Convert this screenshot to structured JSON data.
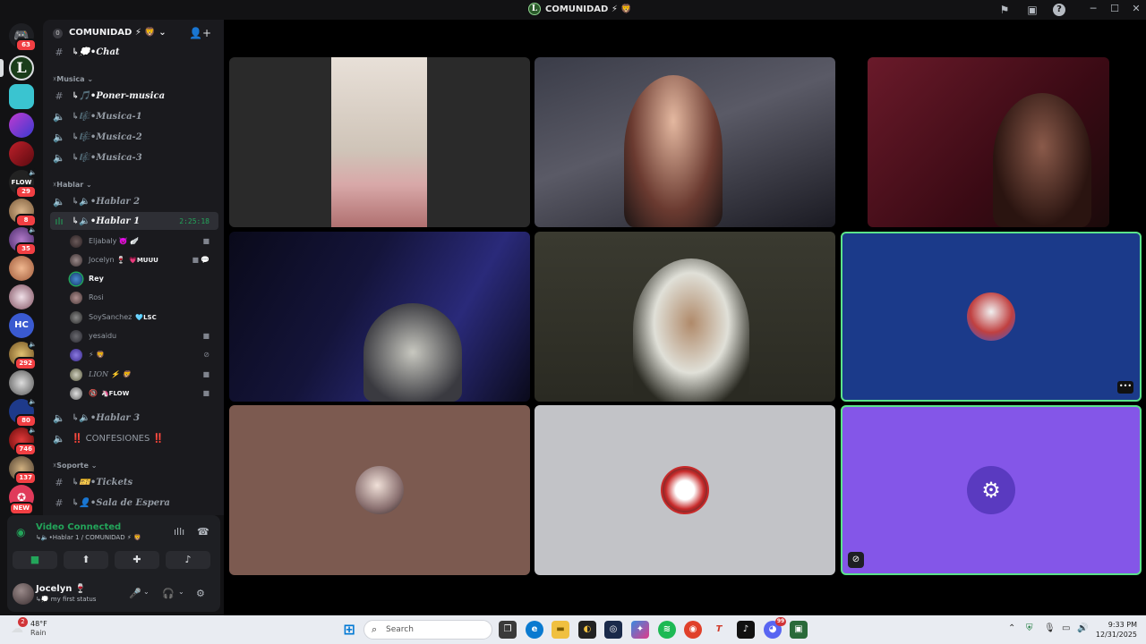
{
  "window": {
    "title": "COMUNIDAD ⚡ 🦁",
    "logo_letter": "L"
  },
  "server": {
    "name": "COMUNIDAD ⚡ 🦁",
    "chevron": "⌄",
    "boost": "0"
  },
  "rail_badges": [
    "63",
    "29",
    "8",
    "35",
    "292",
    "80",
    "746",
    "137",
    "NEW"
  ],
  "categories": {
    "musica": "☓Musica ⌄",
    "hablar": "☓Hablar ⌄",
    "soporte": "☓Soporte ⌄"
  },
  "channels": {
    "chat": "↳💭•Chat",
    "poner_musica": "↳🎵•Poner-musica",
    "musica1": "↳🎼•Musica-1",
    "musica2": "↳🎼•Musica-2",
    "musica3": "↳🎼•Musica-3",
    "hablar2": "↳🔈•Hablar 2",
    "hablar1": "↳🔈•Hablar 1",
    "hablar1_timer": "2:25:18",
    "hablar3": "↳🔈•Hablar 3",
    "confesiones": "‼️ CONFESIONES ‼️",
    "tickets": "↳🎫•Tickets",
    "sala": "↳👤•Sala de Espera"
  },
  "voice_users": [
    {
      "name": "Eljabaly 👿 🪽",
      "tag": ""
    },
    {
      "name": "Jocelyn 🍷",
      "tag": "💗MUUU"
    },
    {
      "name": "Rey",
      "tag": ""
    },
    {
      "name": "Rosi",
      "tag": ""
    },
    {
      "name": "SoySanchez",
      "tag": "🩵LSC"
    },
    {
      "name": "yesaidu",
      "tag": ""
    },
    {
      "name": "⚡ 🦁",
      "tag": ""
    },
    {
      "name": "LION ⚡ 🦁",
      "tag": ""
    },
    {
      "name": "🔞",
      "tag": "🦄FLOW"
    }
  ],
  "voice_panel": {
    "status": "Video Connected",
    "location": "↳🔈•Hablar 1 / COMUNIDAD ⚡ 🦁"
  },
  "user_panel": {
    "name": "Jocelyn 🍷",
    "status": "↳💭 my first status"
  },
  "taskbar": {
    "temp": "48°F",
    "condition": "Rain",
    "weather_badge": "2",
    "search_placeholder": "Search",
    "time": "9:33 PM",
    "date": "12/31/2025",
    "discord_badge": "99"
  },
  "icons": {
    "server_add": "person-add-icon",
    "rail_home": "discord-home-icon",
    "screen_share": "screen-share-icon",
    "activity": "activity-icon",
    "soundboard": "soundboard-icon"
  },
  "colors": {
    "voice_connected": "#23a55a",
    "badge_red": "#f23f43",
    "tile_speaking_border": "#5be38a",
    "tile_blue": "#1b3a8a",
    "tile_brown": "#7c5a50",
    "tile_gray": "#c2c3c7",
    "tile_purple": "#8456e8"
  }
}
